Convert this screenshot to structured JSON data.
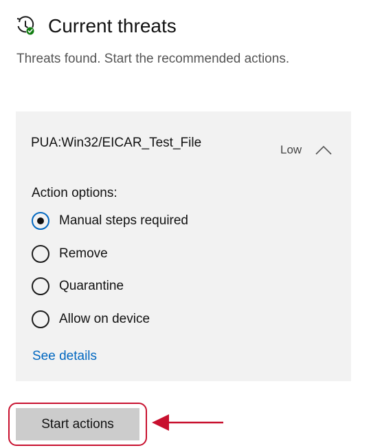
{
  "header": {
    "icon": "virus-shield-clock-icon",
    "title": "Current threats",
    "subtitle": "Threats found. Start the recommended actions."
  },
  "threat": {
    "name": "PUA:Win32/EICAR_Test_File",
    "severity": "Low",
    "expanded": true,
    "action_options_label": "Action options:",
    "options": [
      {
        "label": "Manual steps required",
        "selected": true
      },
      {
        "label": "Remove",
        "selected": false
      },
      {
        "label": "Quarantine",
        "selected": false
      },
      {
        "label": "Allow on device",
        "selected": false
      }
    ],
    "see_details_label": "See details"
  },
  "start_actions_label": "Start actions",
  "colors": {
    "accent": "#0067c0",
    "annotation": "#c8102e",
    "card_background": "#f2f2f2",
    "button_background": "#cccccc"
  }
}
